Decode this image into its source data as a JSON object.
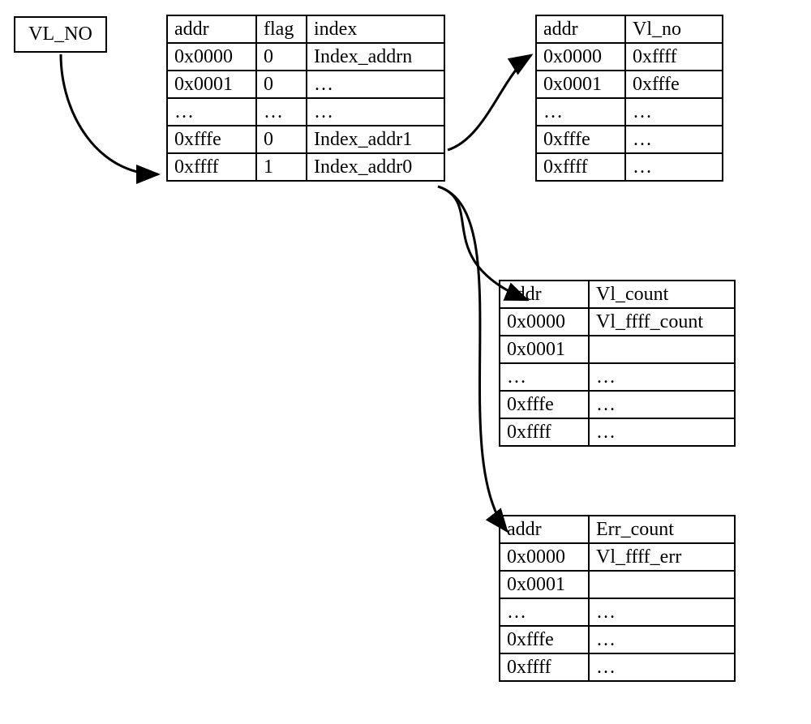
{
  "vlno_label": "VL_NO",
  "table1": {
    "headers": [
      "addr",
      "flag",
      "index"
    ],
    "rows": [
      [
        "0x0000",
        "0",
        "Index_addrn"
      ],
      [
        "0x0001",
        "0",
        "…"
      ],
      [
        "…",
        "…",
        "…"
      ],
      [
        "0xfffe",
        "0",
        "Index_addr1"
      ],
      [
        "0xffff",
        "1",
        "Index_addr0"
      ]
    ]
  },
  "table2": {
    "headers": [
      "addr",
      "Vl_no"
    ],
    "rows": [
      [
        "0x0000",
        "0xffff"
      ],
      [
        "0x0001",
        "0xfffe"
      ],
      [
        "…",
        "…"
      ],
      [
        "0xfffe",
        "…"
      ],
      [
        "0xffff",
        "…"
      ]
    ]
  },
  "table3": {
    "headers": [
      "addr",
      "Vl_count"
    ],
    "rows": [
      [
        "0x0000",
        "Vl_ffff_count"
      ],
      [
        "0x0001",
        ""
      ],
      [
        "…",
        "…"
      ],
      [
        "0xfffe",
        "…"
      ],
      [
        "0xffff",
        "…"
      ]
    ]
  },
  "table4": {
    "headers": [
      "addr",
      "Err_count"
    ],
    "rows": [
      [
        "0x0000",
        "Vl_ffff_err"
      ],
      [
        "0x0001",
        ""
      ],
      [
        "…",
        "…"
      ],
      [
        "0xfffe",
        "…"
      ],
      [
        "0xffff",
        "…"
      ]
    ]
  }
}
